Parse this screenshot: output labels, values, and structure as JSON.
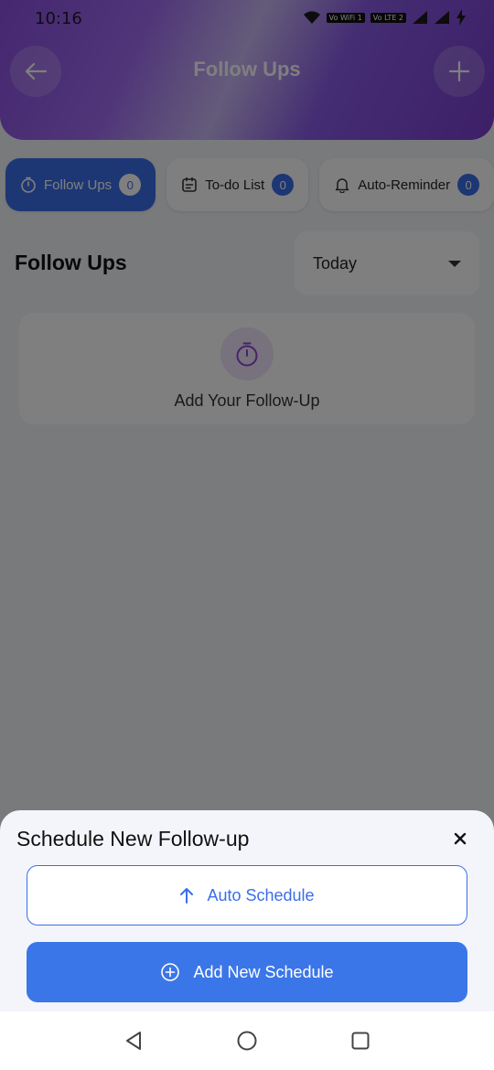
{
  "status_bar": {
    "time": "10:16",
    "badges": [
      "Vo WiFi 1",
      "Vo LTE 2"
    ]
  },
  "header": {
    "title": "Follow Ups",
    "back_icon": "arrow-left-icon",
    "add_icon": "plus-icon"
  },
  "tabs": [
    {
      "label": "Follow Ups",
      "count": "0",
      "icon": "timer-icon",
      "active": true
    },
    {
      "label": "To-do List",
      "count": "0",
      "icon": "calendar-icon",
      "active": false
    },
    {
      "label": "Auto-Reminder",
      "count": "0",
      "icon": "bell-icon",
      "active": false
    }
  ],
  "section": {
    "title": "Follow Ups",
    "filter_value": "Today"
  },
  "empty_state": {
    "text": "Add Your Follow-Up",
    "icon": "timer-icon"
  },
  "sheet": {
    "title": "Schedule New Follow-up",
    "auto_label": "Auto Schedule",
    "add_label": "Add New Schedule"
  },
  "colors": {
    "primary": "#3b6ee8",
    "header_start": "#8a4fe0",
    "accent_icon": "#8e44d6"
  }
}
